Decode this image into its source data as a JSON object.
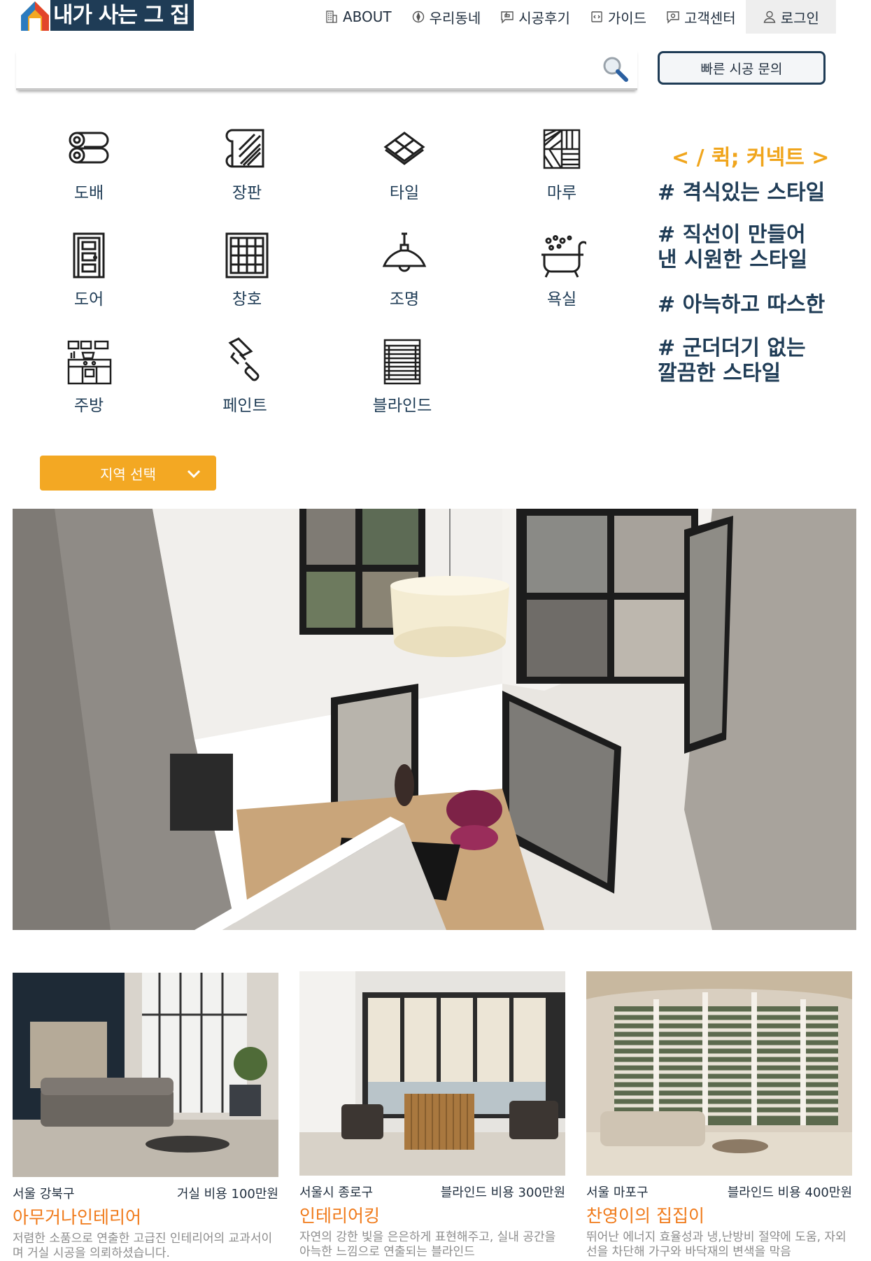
{
  "brand": {
    "name": "내가 사는 그 집"
  },
  "nav": [
    {
      "label": "ABOUT",
      "icon": "building-icon"
    },
    {
      "label": "우리동네",
      "icon": "compass-icon"
    },
    {
      "label": "시공후기",
      "icon": "review-bubble-icon"
    },
    {
      "label": "가이드",
      "icon": "code-doc-icon"
    },
    {
      "label": "고객센터",
      "icon": "support-bubble-icon"
    },
    {
      "label": "로그인",
      "icon": "user-icon"
    }
  ],
  "search": {
    "placeholder": ""
  },
  "quick_inquiry": {
    "label": "빠른 시공 문의"
  },
  "categories": [
    {
      "label": "도배",
      "icon": "wallpaper-roll-icon"
    },
    {
      "label": "장판",
      "icon": "flooring-roll-icon"
    },
    {
      "label": "타일",
      "icon": "tile-icon"
    },
    {
      "label": "마루",
      "icon": "wood-floor-icon"
    },
    {
      "label": "도어",
      "icon": "door-icon"
    },
    {
      "label": "창호",
      "icon": "window-icon"
    },
    {
      "label": "조명",
      "icon": "pendant-lamp-icon"
    },
    {
      "label": "욕실",
      "icon": "bathtub-icon"
    },
    {
      "label": "주방",
      "icon": "kitchen-icon"
    },
    {
      "label": "페인트",
      "icon": "paint-roller-icon"
    },
    {
      "label": "블라인드",
      "icon": "blind-icon"
    }
  ],
  "quick_connect": {
    "title": "< / 퀵; 커넥트 >",
    "tags": [
      "# 격식있는 스타일",
      "# 직선이 만들어",
      "낸 시원한 스타일",
      "# 아늑하고 따스한",
      "# 군더더기 없는",
      "깔끔한 스타일"
    ]
  },
  "region": {
    "label": "지역 선택"
  },
  "cards": [
    {
      "location": "서울 강북구",
      "cost": "거실 비용 100만원",
      "title": "아무거나인테리어",
      "desc": "저렴한 소품으로 연출한 고급진 인테리어의 교과서이며 거실 시공을 의뢰하셨습니다."
    },
    {
      "location": "서울시 종로구",
      "cost": "블라인드 비용 300만원",
      "title": "인테리어킹",
      "desc": "자연의 강한 빛을 은은하게 표현해주고, 실내 공간을 아늑한 느낌으로 연출되는 블라인드"
    },
    {
      "location": "서울 마포구",
      "cost": "블라인드 비용 400만원",
      "title": "찬영이의 집집이",
      "desc": "뛰어난 에너지 효율성과 냉,난방비 절약에 도움, 자외선을 차단해 가구와 바닥재의 변색을 막음"
    }
  ],
  "colors": {
    "brand_navy": "#1f3c56",
    "accent_orange": "#f3a823",
    "title_orange": "#f07a1a"
  }
}
